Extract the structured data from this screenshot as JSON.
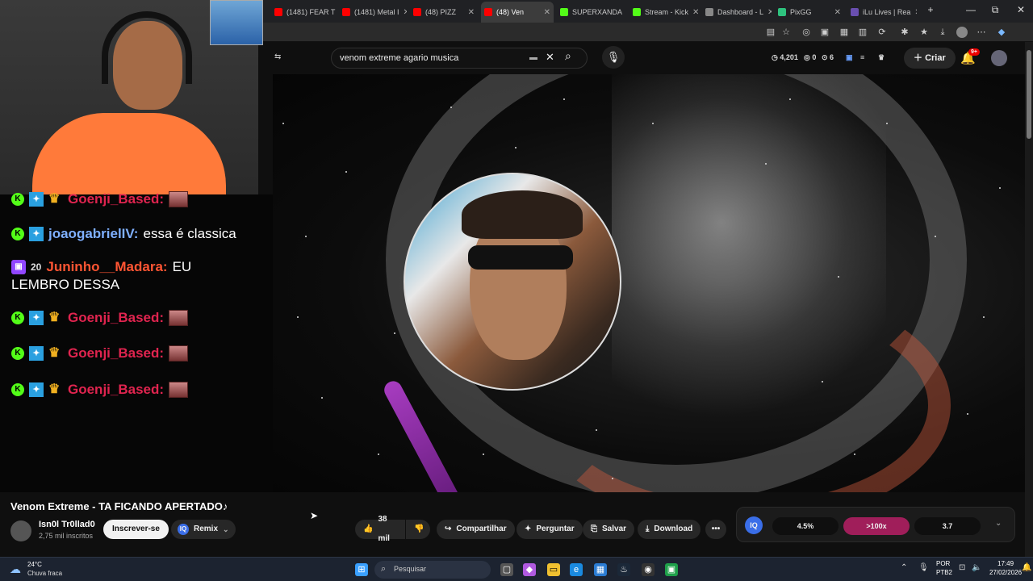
{
  "browser": {
    "tabs": [
      {
        "label": "(1481) FEAR TI",
        "color": "#ff0000"
      },
      {
        "label": "(1481) Metal I",
        "color": "#ff0000"
      },
      {
        "label": "(48) PIZZ",
        "color": "#ff0000"
      },
      {
        "label": "(48) Ven",
        "color": "#ff0000"
      },
      {
        "label": "SUPERXANDA",
        "color": "#53fc18"
      },
      {
        "label": "Stream - Kick",
        "color": "#53fc18"
      },
      {
        "label": "Dashboard - L",
        "color": "#888888"
      },
      {
        "label": "PixGG",
        "color": "#2ec27e"
      },
      {
        "label": "iLu Lives | Rea",
        "color": "#6a4fb0"
      }
    ],
    "new_tab": "+",
    "window_controls": {
      "minimize": "—",
      "maximize": "⧉",
      "close": "✕"
    }
  },
  "youtube": {
    "search": {
      "value": "venom extreme agario musica"
    },
    "header_stats": {
      "views": "4,201",
      "count_a": "0",
      "count_b": "6"
    },
    "create_label": "Criar",
    "notif_badge": "9+"
  },
  "overlay": {
    "chat": [
      {
        "platform": "kick",
        "user": "Goenji_Based:",
        "user_color": "#e0244f",
        "message": "",
        "badges": [
          "blue",
          "crown"
        ],
        "emote": true
      },
      {
        "platform": "kick",
        "user": "joaogabrielIV:",
        "user_color": "#7fb0ff",
        "message": "essa é classica",
        "badges": [
          "blue"
        ],
        "emote": false
      },
      {
        "platform": "twitch",
        "user": "Juninho__Madara:",
        "user_color": "#ff5533",
        "message": "EU",
        "message2": "LEMBRO DESSA",
        "badges": [
          "twenty"
        ],
        "emote": false
      },
      {
        "platform": "kick",
        "user": "Goenji_Based:",
        "user_color": "#e0244f",
        "message": "",
        "badges": [
          "blue",
          "crown"
        ],
        "emote": true
      },
      {
        "platform": "kick",
        "user": "Goenji_Based:",
        "user_color": "#e0244f",
        "message": "",
        "badges": [
          "blue",
          "crown"
        ],
        "emote": true
      },
      {
        "platform": "kick",
        "user": "Goenji_Based:",
        "user_color": "#e0244f",
        "message": "",
        "badges": [
          "blue",
          "crown"
        ],
        "emote": true
      }
    ]
  },
  "video": {
    "title": "Venom Extreme - TA FICANDO APERTADO♪",
    "channel_name": "Isn0l Tr0llad0",
    "subscribers": "2,75 mil inscritos",
    "subscribe_label": "Inscrever-se",
    "remix_label": "Remix",
    "likes": "38 mil",
    "share_label": "Compartilhar",
    "ask_label": "Perguntar",
    "save_label": "Salvar",
    "download_label": "Download",
    "more_label": "•••"
  },
  "iq_panel": {
    "badge": "IQ",
    "values": [
      "4.5%",
      ">100x",
      "3.7"
    ],
    "highlight_color": "#a01e5a"
  },
  "taskbar": {
    "weather_temp": "24°C",
    "weather_desc": "Chuva fraca",
    "search_placeholder": "Pesquisar",
    "lang": "POR",
    "kbd": "PTB2",
    "time": "17:49",
    "date": "27/02/2026"
  }
}
